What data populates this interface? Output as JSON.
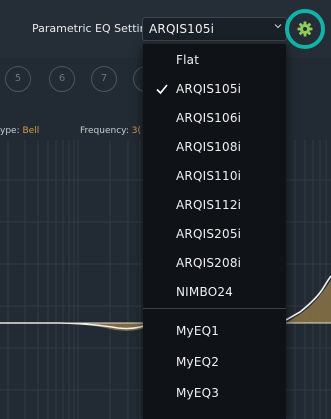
{
  "header": {
    "eq_setting_label": "Parametric EQ Setting",
    "selected_eq": "ARQIS105i"
  },
  "band_buttons": [
    "5",
    "6",
    "7"
  ],
  "band_info": {
    "type_label": "ype:",
    "type_value": "Bell",
    "frequency_label": "Frequency:",
    "frequency_value": "3("
  },
  "dropdown": {
    "preset_items": [
      "Flat",
      "ARQIS105i",
      "ARQIS106i",
      "ARQIS108i",
      "ARQIS110i",
      "ARQIS112i",
      "ARQIS205i",
      "ARQIS208i",
      "NIMBO24"
    ],
    "user_items": [
      "MyEQ1",
      "MyEQ2",
      "MyEQ3"
    ],
    "checked_item": "ARQIS105i"
  },
  "colors": {
    "accent": "#12b3a8",
    "curve_fill": "#8a7446",
    "value_text": "#d99a4a"
  },
  "icons": {
    "settings": "gear-icon",
    "dropdown_arrow": "chevron-down-icon",
    "checkmark": "checkmark-icon"
  }
}
